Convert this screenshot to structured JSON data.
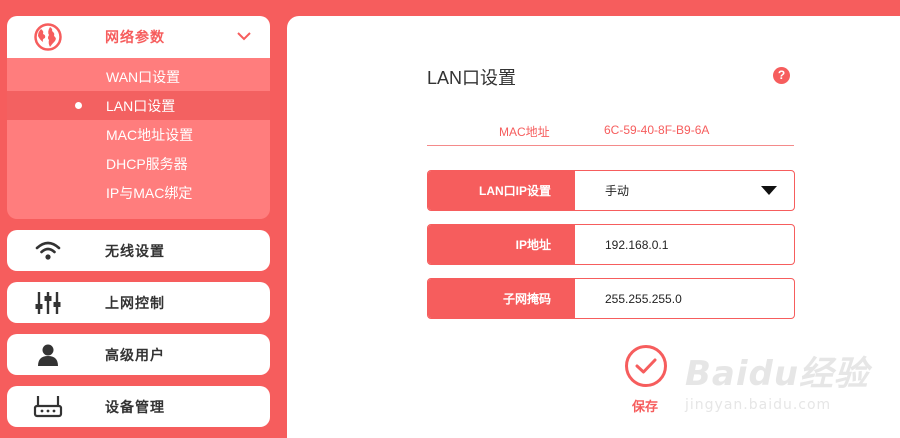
{
  "sidebar": {
    "network": {
      "label": "网络参数",
      "icon": "globe-icon",
      "submenu": [
        {
          "label": "WAN口设置",
          "selected": false
        },
        {
          "label": "LAN口设置",
          "selected": true
        },
        {
          "label": "MAC地址设置",
          "selected": false
        },
        {
          "label": "DHCP服务器",
          "selected": false
        },
        {
          "label": "IP与MAC绑定",
          "selected": false
        }
      ]
    },
    "wireless": {
      "label": "无线设置",
      "icon": "wifi-icon"
    },
    "access_control": {
      "label": "上网控制",
      "icon": "sliders-icon"
    },
    "advanced_user": {
      "label": "高级用户",
      "icon": "user-icon"
    },
    "device_mgmt": {
      "label": "设备管理",
      "icon": "router-icon"
    }
  },
  "main": {
    "title": "LAN口设置",
    "help_icon": "?",
    "mac": {
      "label": "MAC地址",
      "value": "6C-59-40-8F-B9-6A"
    },
    "fields": [
      {
        "label": "LAN口IP设置",
        "value": "手动",
        "type": "select"
      },
      {
        "label": "IP地址",
        "value": "192.168.0.1",
        "type": "input"
      },
      {
        "label": "子网掩码",
        "value": "255.255.255.0",
        "type": "input"
      }
    ],
    "save_label": "保存"
  },
  "watermark": {
    "main": "Baidu经验",
    "sub": "jingyan.baidu.com"
  },
  "colors": {
    "accent": "#f65d5d",
    "submenu_bg": "#ff7d7d",
    "selected_bg": "#f36161"
  }
}
